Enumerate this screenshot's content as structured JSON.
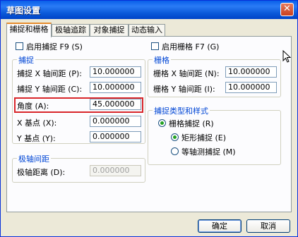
{
  "window": {
    "title": "草图设置"
  },
  "tabs": [
    {
      "label": "捕捉和栅格"
    },
    {
      "label": "极轴追踪"
    },
    {
      "label": "对象捕捉"
    },
    {
      "label": "动态输入"
    }
  ],
  "snap": {
    "enable_label": "启用捕捉 F9 (S)",
    "enabled": false,
    "group_title": "捕捉",
    "x_spacing": {
      "label": "捕捉 X 轴间距 (P):",
      "value": "10.000000"
    },
    "y_spacing": {
      "label": "捕捉 Y 轴间距 (C):",
      "value": "10.000000"
    },
    "angle": {
      "label": "角度 (A):",
      "value": "45.000000"
    },
    "x_base": {
      "label": "X 基点 (X):",
      "value": "0.000000"
    },
    "y_base": {
      "label": "Y 基点 (Y):",
      "value": "0.000000"
    }
  },
  "polar": {
    "group_title": "极轴间距",
    "distance": {
      "label": "极轴距离 (D):",
      "value": "0.000000"
    }
  },
  "grid": {
    "enable_label": "启用栅格 F7 (G)",
    "enabled": false,
    "group_title": "栅格",
    "x_spacing": {
      "label": "栅格 X 轴间距 (N):",
      "value": "10.000000"
    },
    "y_spacing": {
      "label": "栅格 Y 轴间距 (I):",
      "value": "10.000000"
    }
  },
  "snap_type": {
    "group_title": "捕捉类型和样式",
    "grid_snap": {
      "label": "栅格捕捉 (R)",
      "selected": true
    },
    "rect_snap": {
      "label": "矩形捕捉 (E)",
      "selected": true
    },
    "iso_snap": {
      "label": "等轴测捕捉 (M)",
      "selected": false
    }
  },
  "buttons": {
    "ok": "确定",
    "cancel": "取消"
  },
  "colors": {
    "titlebar": "#0A5FE9",
    "highlight": "#D9262A",
    "group_title": "#0046D5"
  }
}
